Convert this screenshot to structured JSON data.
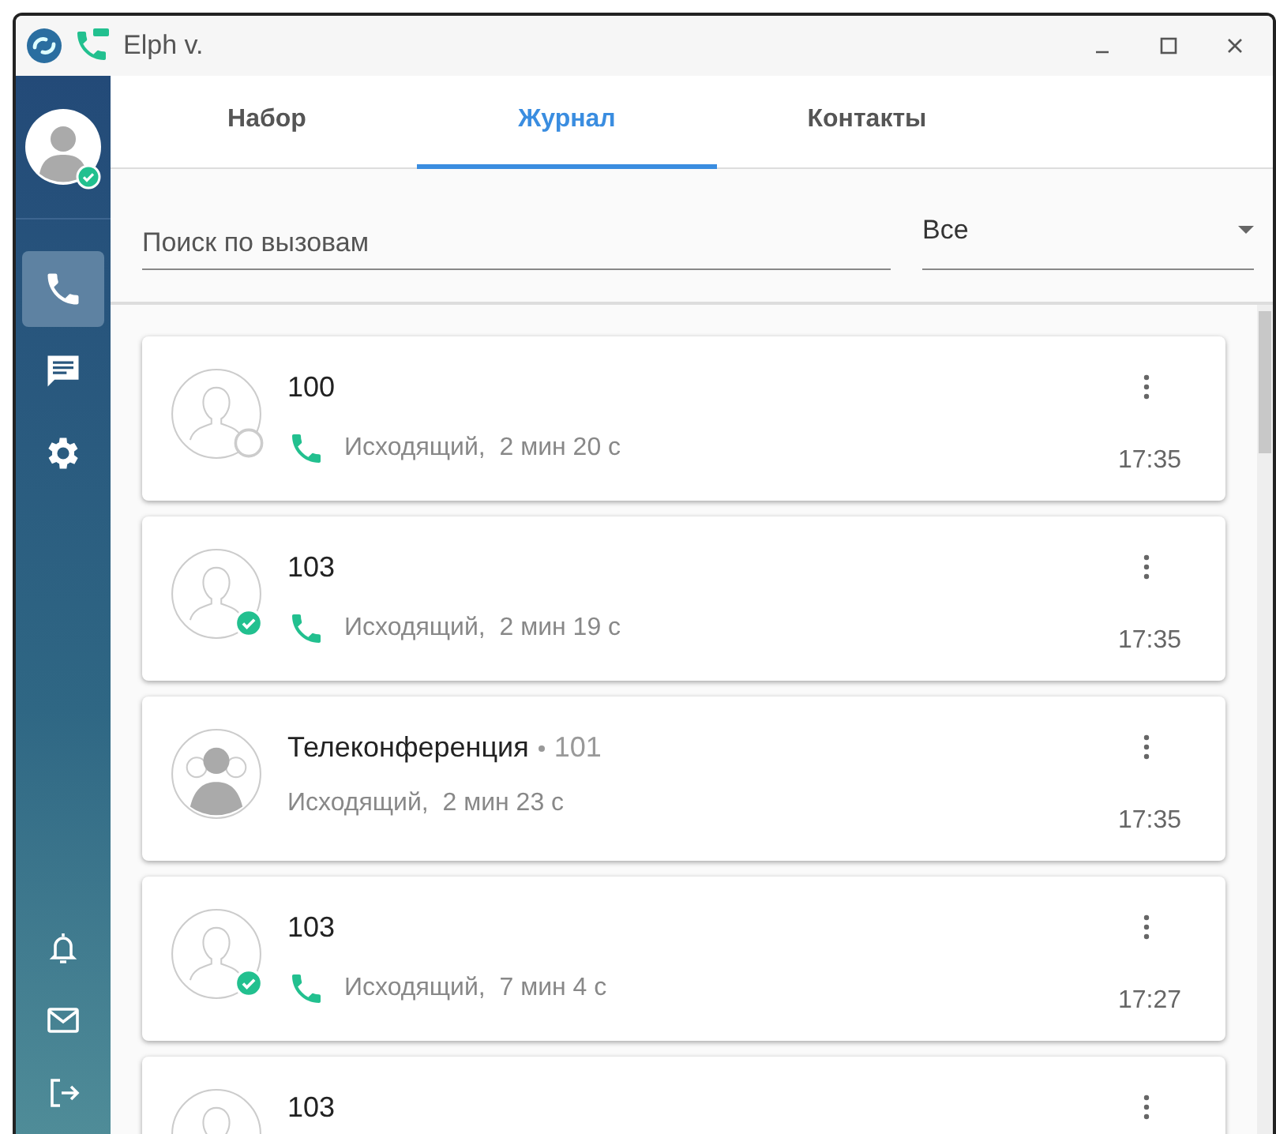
{
  "window": {
    "title": "Elph v."
  },
  "sidebar": {
    "online": true,
    "items": [
      {
        "kind": "phone",
        "selected": true
      },
      {
        "kind": "chat",
        "selected": false
      },
      {
        "kind": "settings",
        "selected": false
      }
    ]
  },
  "tabs": [
    {
      "label": "Набор",
      "selected": false
    },
    {
      "label": "Журнал",
      "selected": true
    },
    {
      "label": "Контакты",
      "selected": false
    }
  ],
  "search": {
    "placeholder": "Поиск по вызовам"
  },
  "filter": {
    "value": "Все"
  },
  "calls": [
    {
      "kind": "contact",
      "online": false,
      "name": "100",
      "detail": "Исходящий,  2 мин 20 с",
      "time": "17:35"
    },
    {
      "kind": "contact",
      "online": true,
      "name": "103",
      "detail": "Исходящий,  2 мин 19 с",
      "time": "17:35"
    },
    {
      "kind": "conference",
      "name": "Телеконференция",
      "number": "101",
      "detail": "Исходящий,  2 мин 23 с",
      "time": "17:35"
    },
    {
      "kind": "contact",
      "online": true,
      "name": "103",
      "detail": "Исходящий,  7 мин 4 с",
      "time": "17:27"
    },
    {
      "kind": "contact",
      "name": "103"
    }
  ]
}
